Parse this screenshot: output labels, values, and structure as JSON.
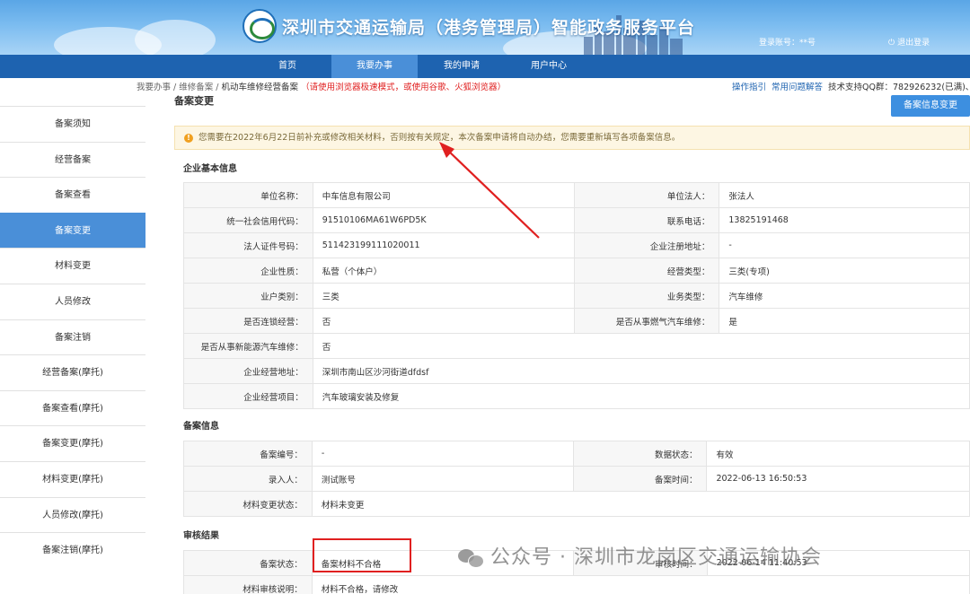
{
  "header": {
    "site_title": "深圳市交通运输局（港务管理局）智能政务服务平台",
    "account": "登录账号：**号",
    "logout": "退出登录"
  },
  "nav": {
    "items": [
      {
        "label": "首页"
      },
      {
        "label": "我要办事"
      },
      {
        "label": "我的申请"
      },
      {
        "label": "用户中心"
      }
    ],
    "active": "我要办事"
  },
  "breadcrumb": {
    "items": [
      "我要办事",
      "维修备案"
    ],
    "current": "机动车维修经营备案",
    "warning": "（请使用浏览器极速模式，或使用谷歌、火狐浏览器）"
  },
  "help": {
    "guide": "操作指引",
    "faq": "常用问题解答",
    "support": "技术支持QQ群：782926232(已满)、"
  },
  "sidebar": {
    "items": [
      {
        "label": "备案须知"
      },
      {
        "label": "经营备案"
      },
      {
        "label": "备案查看"
      },
      {
        "label": "备案变更"
      },
      {
        "label": "材料变更"
      },
      {
        "label": "人员修改"
      },
      {
        "label": "备案注销"
      },
      {
        "label": "经营备案(摩托)"
      },
      {
        "label": "备案查看(摩托)"
      },
      {
        "label": "备案变更(摩托)"
      },
      {
        "label": "材料变更(摩托)"
      },
      {
        "label": "人员修改(摩托)"
      },
      {
        "label": "备案注销(摩托)"
      }
    ],
    "active": "备案变更"
  },
  "main": {
    "title": "备案变更",
    "change_button": "备案信息变更",
    "notice": "您需要在2022年6月22日前补充或修改相关材料，否则按有关规定，本次备案申请将自动办结，您需要重新填写各项备案信息。"
  },
  "enterprise": {
    "section_title": "企业基本信息",
    "unit_name_label": "单位名称：",
    "unit_name": "中车信息有限公司",
    "legal_person_label": "单位法人：",
    "legal_person": "张法人",
    "credit_code_label": "统一社会信用代码：",
    "credit_code": "91510106MA61W6PD5K",
    "phone_label": "联系电话：",
    "phone": "13825191468",
    "id_label": "法人证件号码：",
    "id_no": "511423199111020011",
    "reg_addr_label": "企业注册地址：",
    "reg_addr": "-",
    "nature_label": "企业性质：",
    "nature": "私营（个体户）",
    "biz_type_label": "经营类型：",
    "biz_type": "三类(专项)",
    "household_label": "业户类别：",
    "household": "三类",
    "service_type_label": "业务类型：",
    "service_type": "汽车维修",
    "chain_label": "是否连锁经营：",
    "chain": "否",
    "gas_label": "是否从事燃气汽车维修：",
    "gas": "是",
    "nev_label": "是否从事新能源汽车维修：",
    "nev": "否",
    "op_addr_label": "企业经营地址：",
    "op_addr": "深圳市南山区沙河街道dfdsf",
    "project_label": "企业经营项目：",
    "project": "汽车玻璃安装及修复"
  },
  "record": {
    "section_title": "备案信息",
    "no_label": "备案编号：",
    "no": "-",
    "data_status_label": "数据状态：",
    "data_status": "有效",
    "entry_label": "录入人：",
    "entry": "测试账号",
    "time_label": "备案时间：",
    "time": "2022-06-13 16:50:53",
    "material_label": "材料变更状态：",
    "material": "材料未变更"
  },
  "review": {
    "section_title": "审核结果",
    "status_label": "备案状态：",
    "status": "备案材料不合格",
    "review_time_label": "审核时间：",
    "review_time": "2022-06-14 11:40:53",
    "comment_label": "材料审核说明：",
    "comment": "材料不合格，请修改"
  },
  "watermark": {
    "text": "公众号 · 深圳市龙岗区交通运输协会"
  },
  "colors": {
    "nav_bg": "#1e63b0",
    "active_bg": "#4a8fd8",
    "status_valid": "#2fa84f",
    "status_fail": "#e02020"
  }
}
